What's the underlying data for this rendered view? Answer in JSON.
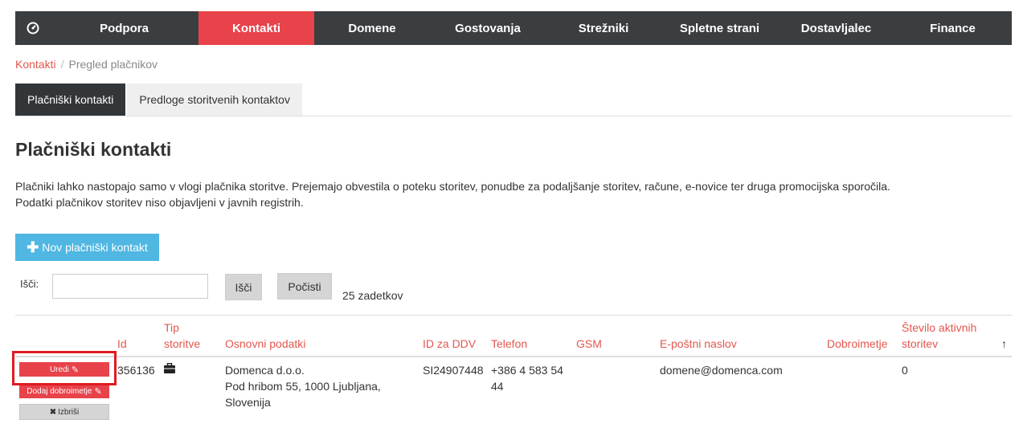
{
  "nav": {
    "items": [
      "Podpora",
      "Kontakti",
      "Domene",
      "Gostovanja",
      "Strežniki",
      "Spletne strani",
      "Dostavljalec",
      "Finance"
    ],
    "active": "Kontakti",
    "home_icon": "dashboard-icon"
  },
  "breadcrumb": {
    "parent": "Kontakti",
    "separator": "/",
    "current": "Pregled plačnikov"
  },
  "tabs": [
    "Plačniški kontakti",
    "Predloge storitvenih kontaktov"
  ],
  "page": {
    "title": "Plačniški kontakti",
    "desc_line1": "Plačniki lahko nastopajo samo v vlogi plačnika storitve. Prejemajo obvestila o poteku storitev, ponudbe za podaljšanje storitev, račune, e-novice ter druga promocijska sporočila.",
    "desc_line2": "Podatki plačnikov storitev niso objavljeni v javnih registrih."
  },
  "new_button": {
    "icon": "plus-icon",
    "label": "Nov plačniški kontakt"
  },
  "search": {
    "label": "Išči:",
    "value": "",
    "search_button": "Išči",
    "clear_button": "Počisti",
    "result_count": "25 zadetkov"
  },
  "table": {
    "headers": {
      "id": "Id",
      "type_line1": "Tip",
      "type_line2": "storitve",
      "basic": "Osnovni podatki",
      "vat": "ID za DDV",
      "phone": "Telefon",
      "gsm": "GSM",
      "email": "E-poštni naslov",
      "credit": "Dobroimetje",
      "active_line1": "Število aktivnih",
      "active_line2": "storitev",
      "sort_icon": "sort-arrow-up-icon",
      "sort_symbol": "↑"
    },
    "rows": [
      {
        "actions": {
          "edit": "Uredi",
          "add_credit": "Dodaj dobroimetje",
          "delete": "Izbriši"
        },
        "id": "356136",
        "type_icon": "briefcase-icon",
        "basic_line1": "Domenca d.o.o.",
        "basic_line2": "Pod hribom 55, 1000 Ljubljana,",
        "basic_line3": "Slovenija",
        "vat": "SI24907448",
        "phone_line1": "+386 4 583 54",
        "phone_line2": "44",
        "gsm": "",
        "email": "domene@domenca.com",
        "credit": "",
        "active_services": "0"
      }
    ]
  },
  "colors": {
    "nav_bg": "#3b3e40",
    "accent": "#e8424a",
    "link": "#e3574e",
    "info_button": "#4fb7e2"
  }
}
